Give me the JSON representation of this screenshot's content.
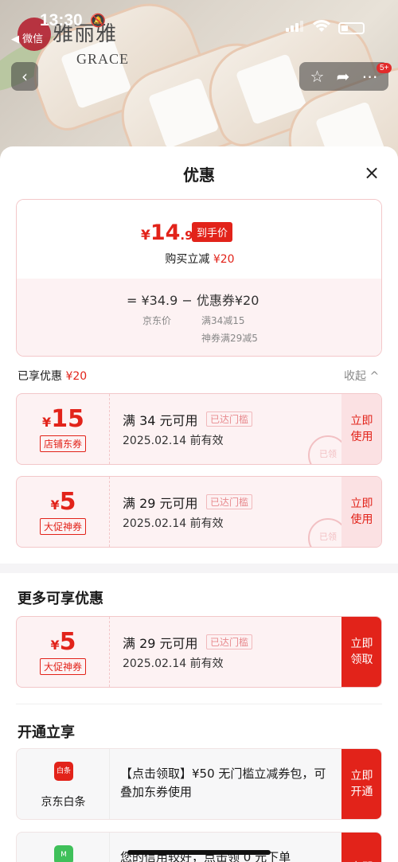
{
  "status_bar": {
    "time": "13:30",
    "back_app": "◀ 微信"
  },
  "brand": {
    "logo_cn": "雅丽雅",
    "logo_en": "GRACE"
  },
  "nav": {
    "badge": "5+"
  },
  "sheet": {
    "title": "优惠",
    "close": "×",
    "price_card": {
      "yen": "¥",
      "final_int": "14",
      "final_dec": ".9",
      "final_tag": "到手价",
      "instant_label": "购买立减",
      "instant_value": "¥20",
      "calc": "=  ¥34.9  −  优惠券¥20",
      "jd_price_label": "京东价",
      "coupon_detail_1": "满34减15",
      "coupon_detail_2": "神券满29减5"
    },
    "enjoyed": {
      "label": "已享优惠",
      "value": "¥20",
      "collapse": "收起 ^"
    },
    "enjoyed_coupons": [
      {
        "yen": "¥",
        "amount": "15",
        "kind": "店铺东券",
        "condition": "满 34 元可用",
        "met": "已达门槛",
        "valid": "2025.02.14 前有效",
        "stamp": "已领",
        "action": "立即\n使用"
      },
      {
        "yen": "¥",
        "amount": "5",
        "kind": "大促神券",
        "condition": "满 29 元可用",
        "met": "已达门槛",
        "valid": "2025.02.14 前有效",
        "stamp": "已领",
        "action": "立即\n使用"
      }
    ],
    "more": {
      "title": "更多可享优惠",
      "coupons": [
        {
          "yen": "¥",
          "amount": "5",
          "kind": "大促神券",
          "condition": "满 29 元可用",
          "met": "已达门槛",
          "valid": "2025.02.14 前有效",
          "action": "立即\n领取"
        }
      ]
    },
    "open": {
      "title": "开通立享",
      "services": [
        {
          "logo": "白条",
          "name": "京东白条",
          "desc": "【点击领取】¥50 无门槛立减券包，可叠加东券使用",
          "action": "立即\n开通"
        },
        {
          "logo": "M",
          "name": "",
          "desc": "您的信用较好，点击领 0 元下单",
          "action": "立即"
        }
      ]
    }
  },
  "colors": {
    "accent": "#e2231a",
    "coupon_bg": "#fdf2f3",
    "coupon_border": "#f3c7c9"
  }
}
